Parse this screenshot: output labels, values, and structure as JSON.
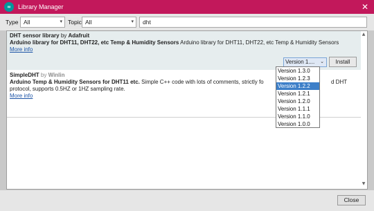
{
  "window": {
    "title": "Library Manager",
    "app_icon_glyph": "∞",
    "close_glyph": "✕"
  },
  "filters": {
    "type_label": "Type",
    "type_value": "All",
    "topic_label": "Topic",
    "topic_value": "All",
    "search_value": "dht"
  },
  "libraries": [
    {
      "name": "DHT sensor library",
      "by": "by",
      "author": "Adafruit",
      "summary": "Arduino library for DHT11, DHT22, etc Temp & Humidity Sensors",
      "description": "Arduino library for DHT11, DHT22, etc Temp & Humidity Sensors",
      "more_info": "More info",
      "version_selected": "Version 1....",
      "install_label": "Install"
    },
    {
      "name": "SimpleDHT",
      "by": "by",
      "author": "Winlin",
      "summary": "Arduino Temp & Humidity Sensors for DHT11 etc.",
      "description_line1": "Simple C++ code with lots of comments, strictly fo",
      "description_line1_tail": "d DHT",
      "description_line2": "protocol, supports 0.5HZ or 1HZ sampling rate.",
      "more_info": "More info"
    }
  ],
  "version_dropdown": {
    "options": [
      "Version 1.3.0",
      "Version 1.2.3",
      "Version 1.2.2",
      "Version 1.2.1",
      "Version 1.2.0",
      "Version 1.1.1",
      "Version 1.1.0",
      "Version 1.0.0"
    ],
    "highlighted": "Version 1.2.2"
  },
  "footer": {
    "close_label": "Close"
  },
  "colors": {
    "titlebar": "#c2185b",
    "highlight": "#3d7fc8",
    "link": "#1a52a5"
  }
}
